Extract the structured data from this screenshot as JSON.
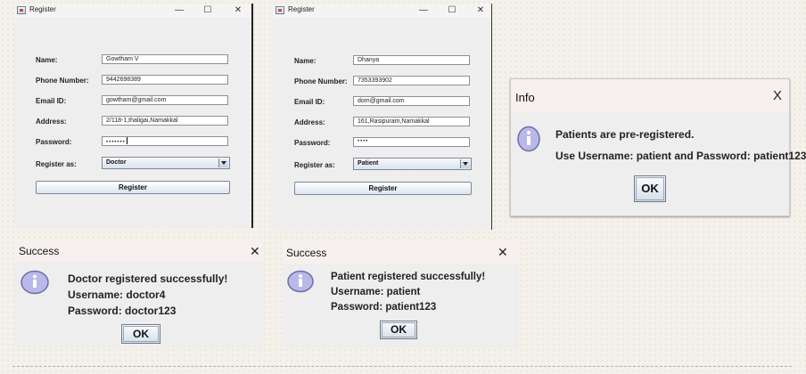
{
  "doctor_register": {
    "title": "Register",
    "name_label": "Name:",
    "name_value": "Gowtham V",
    "phone_label": "Phone Number:",
    "phone_value": "9442698389",
    "email_label": "Email ID:",
    "email_value": "gowtham@gmail.com",
    "address_label": "Address:",
    "address_value": "2/118-1,thaligai,Namakkal",
    "password_label": "Password:",
    "password_value": "•••••••",
    "role_label": "Register as:",
    "role_value": "Doctor",
    "button": "Register"
  },
  "patient_register": {
    "title": "Register",
    "name_label": "Name:",
    "name_value": "Dhanya",
    "phone_label": "Phone Number:",
    "phone_value": "7353393902",
    "email_label": "Email ID:",
    "email_value": "dom@gmail.com",
    "address_label": "Address:",
    "address_value": "161,Rasipuram,Namakkal",
    "password_label": "Password:",
    "password_value": "••••",
    "role_label": "Register as:",
    "role_value": "Patient",
    "button": "Register"
  },
  "info_dialog": {
    "title": "Info",
    "close": "X",
    "line1": "Patients are pre-registered.",
    "line2": "Use Username: patient and Password: patient123",
    "ok": "OK"
  },
  "doctor_success": {
    "title": "Success",
    "close": "✕",
    "line1": "Doctor registered successfully!",
    "line2": "Username: doctor4",
    "line3": "Password: doctor123",
    "ok": "OK"
  },
  "patient_success": {
    "title": "Success",
    "close": "✕",
    "line1": "Patient registered successfully!",
    "line2": "Username: patient",
    "line3": "Password: patient123",
    "ok": "OK"
  },
  "window_controls": {
    "minimize": "—",
    "maximize": "☐",
    "close": "✕"
  },
  "colors": {
    "dialog_bg": "#eeeeee",
    "info_icon": "#b9b9e8",
    "page_bg": "#f4f0ea"
  }
}
